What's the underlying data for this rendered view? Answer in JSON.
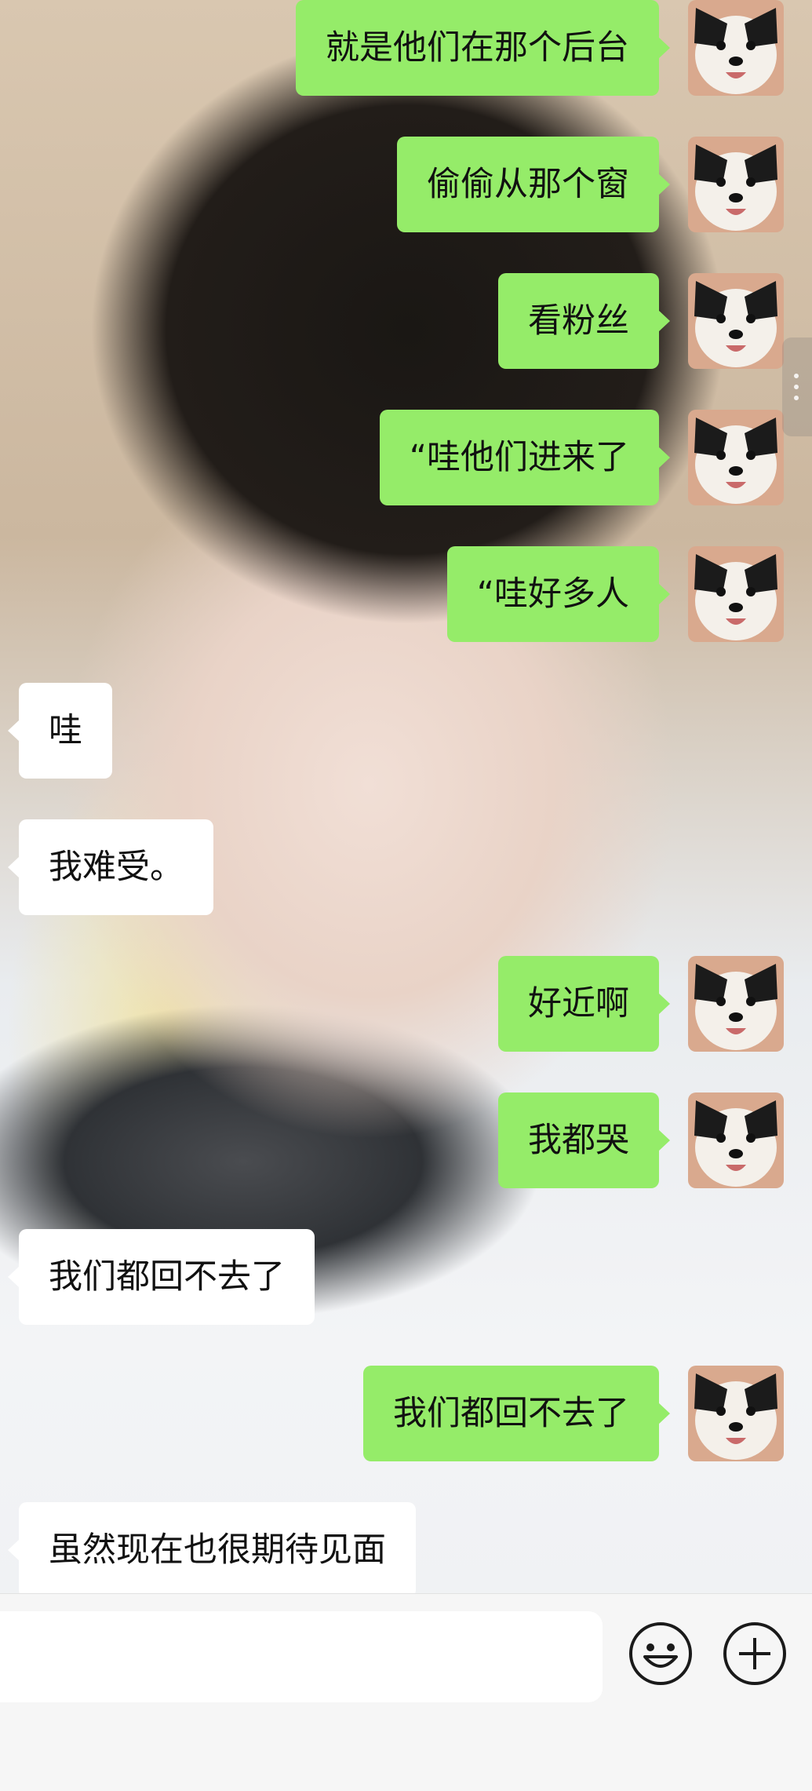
{
  "chat": {
    "messages": [
      {
        "side": "out",
        "text": "就是他们在那个后台"
      },
      {
        "side": "out",
        "text": "偷偷从那个窗"
      },
      {
        "side": "out",
        "text": "看粉丝"
      },
      {
        "side": "out",
        "text": "“哇他们进来了"
      },
      {
        "side": "out",
        "text": "“哇好多人"
      },
      {
        "side": "in",
        "text": "哇"
      },
      {
        "side": "in",
        "text": "我难受。"
      },
      {
        "side": "out",
        "text": "好近啊"
      },
      {
        "side": "out",
        "text": "我都哭"
      },
      {
        "side": "in",
        "text": "我们都回不去了"
      },
      {
        "side": "out",
        "text": "我们都回不去了"
      },
      {
        "side": "in",
        "text": "虽然现在也很期待见面"
      }
    ]
  },
  "input_bar": {
    "emoji_icon": "smiley-icon",
    "more_icon": "plus-circle-icon"
  },
  "colors": {
    "outgoing_bubble": "#95ec69",
    "incoming_bubble": "#ffffff",
    "input_bar_bg": "#f6f6f6"
  }
}
